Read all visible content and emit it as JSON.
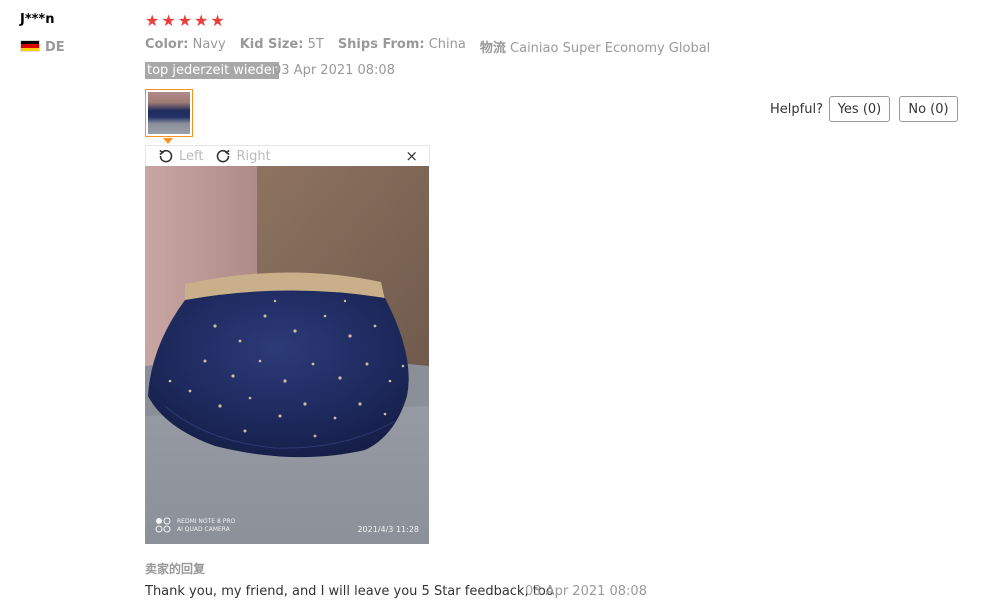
{
  "reviewer": {
    "name": "J***n",
    "country": "DE",
    "flag": "germany-flag-icon"
  },
  "rating": {
    "stars": 5,
    "max": 5,
    "color": "#e8403c"
  },
  "attributes": [
    {
      "label": "Color:",
      "value": "Navy"
    },
    {
      "label": "Kid Size:",
      "value": "5T"
    },
    {
      "label": "Ships From:",
      "value": "China"
    },
    {
      "label": "物流",
      "value": "Cainiao Super Economy Global"
    }
  ],
  "review": {
    "text": "top jederzeit wieder",
    "date": "03 Apr 2021 08:08"
  },
  "helpful": {
    "label": "Helpful?",
    "yes": "Yes (0)",
    "no": "No (0)"
  },
  "viewer": {
    "left": "Left",
    "right": "Right",
    "close": "×"
  },
  "photo_overlay": {
    "device": "REDMI NOTE 8 PRO",
    "camera": "AI QUAD CAMERA",
    "timestamp": "2021/4/3 11:28"
  },
  "seller_reply": {
    "heading": "卖家的回复",
    "text": "Thank you, my friend, and I will leave you 5 Star feedback, too",
    "date": "03 Apr 2021 08:08"
  },
  "colors": {
    "accent": "#f7931e",
    "star": "#e8403c",
    "muted": "#999999"
  }
}
